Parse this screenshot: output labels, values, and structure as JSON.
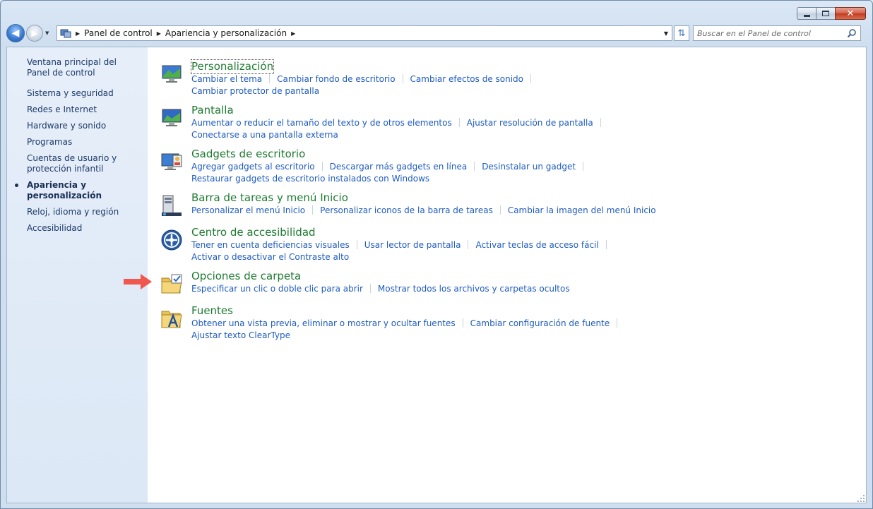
{
  "window": {
    "minimize_icon": "minimize-icon",
    "maximize_icon": "maximize-icon",
    "close_icon": "close-icon"
  },
  "address_bar": {
    "breadcrumbs": [
      "Panel de control",
      "Apariencia y personalización"
    ]
  },
  "search": {
    "placeholder": "Buscar en el Panel de control"
  },
  "sidebar": {
    "items": [
      "Ventana principal del Panel de control",
      "Sistema y seguridad",
      "Redes e Internet",
      "Hardware y sonido",
      "Programas",
      "Cuentas de usuario y protección infantil",
      "Apariencia y personalización",
      "Reloj, idioma y región",
      "Accesibilidad"
    ],
    "active_index": 6
  },
  "categories": [
    {
      "title": "Personalización",
      "icon": "personalization-icon",
      "links": [
        "Cambiar el tema",
        "Cambiar fondo de escritorio",
        "Cambiar efectos de sonido",
        "Cambiar protector de pantalla"
      ]
    },
    {
      "title": "Pantalla",
      "icon": "display-icon",
      "links": [
        "Aumentar o reducir el tamaño del texto y de otros elementos",
        "Ajustar resolución de pantalla",
        "Conectarse a una pantalla externa"
      ]
    },
    {
      "title": "Gadgets de escritorio",
      "icon": "gadgets-icon",
      "links": [
        "Agregar gadgets al escritorio",
        "Descargar más gadgets en línea",
        "Desinstalar un gadget",
        "Restaurar gadgets de escritorio instalados con Windows"
      ]
    },
    {
      "title": "Barra de tareas y menú Inicio",
      "icon": "taskbar-icon",
      "links": [
        "Personalizar el menú Inicio",
        "Personalizar iconos de la barra de tareas",
        "Cambiar la imagen del menú Inicio"
      ]
    },
    {
      "title": "Centro de accesibilidad",
      "icon": "accessibility-icon",
      "links": [
        "Tener en cuenta deficiencias visuales",
        "Usar lector de pantalla",
        "Activar teclas de acceso fácil",
        "Activar o desactivar el Contraste alto"
      ]
    },
    {
      "title": "Opciones de carpeta",
      "icon": "folder-options-icon",
      "links": [
        "Especificar un clic o doble clic para abrir",
        "Mostrar todos los archivos y carpetas ocultos"
      ]
    },
    {
      "title": "Fuentes",
      "icon": "fonts-icon",
      "links": [
        "Obtener una vista previa, eliminar o mostrar y ocultar fuentes",
        "Cambiar configuración de fuente",
        "Ajustar texto ClearType"
      ]
    }
  ],
  "colors": {
    "category_title": "#1e7b30",
    "link": "#1e5bbf",
    "sidebar_text": "#1d3a69",
    "annotation_arrow": "#f0584e"
  }
}
